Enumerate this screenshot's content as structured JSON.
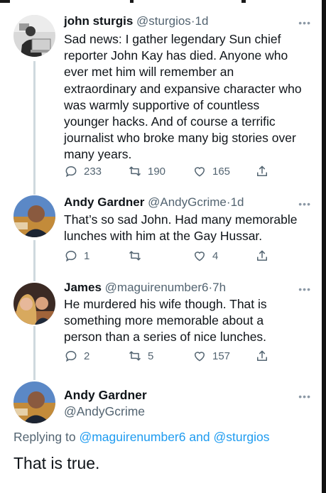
{
  "tweets": [
    {
      "name": "john sturgis",
      "handle": "@sturgios",
      "separator": "·",
      "time": "1d",
      "more": "•••",
      "lines": [
        "Sad news: I gather legendary Sun chief",
        "reporter John Kay has died. Anyone who",
        "ever met him will remember an",
        "extraordinary and expansive character who",
        "was warmly supportive of countless",
        "younger hacks.  And of course a terrific",
        "journalist who broke many big stories over",
        "many years."
      ],
      "replies": "233",
      "retweets": "190",
      "likes": "165"
    },
    {
      "name": "Andy Gardner",
      "handle": "@AndyGcrime",
      "separator": "·",
      "time": "1d",
      "more": "•••",
      "lines": [
        "That’s so sad John. Had many memorable",
        "lunches with him at the Gay Hussar."
      ],
      "replies": "1",
      "retweets": "",
      "likes": "4"
    },
    {
      "name": "James",
      "handle": "@maguirenumber6",
      "separator": "·",
      "time": "7h",
      "more": "•••",
      "lines": [
        "He murdered his wife though. That is",
        "something more memorable about a",
        "person than a series of nice lunches."
      ],
      "replies": "2",
      "retweets": "5",
      "likes": "157"
    }
  ],
  "focused": {
    "name": "Andy Gardner",
    "handle": "@AndyGcrime",
    "more": "•••",
    "replying_prefix": "Replying to",
    "replying_to_1": "@maguirenumber6",
    "replying_and": "and",
    "replying_to_2": "@sturgios",
    "text": "That is true."
  },
  "colors": {
    "accent": "#1d9bf0",
    "secondary_text": "#536471",
    "thread_line": "#cfd9de"
  },
  "icons": [
    "reply-icon",
    "retweet-icon",
    "like-icon",
    "share-icon",
    "more-icon"
  ]
}
